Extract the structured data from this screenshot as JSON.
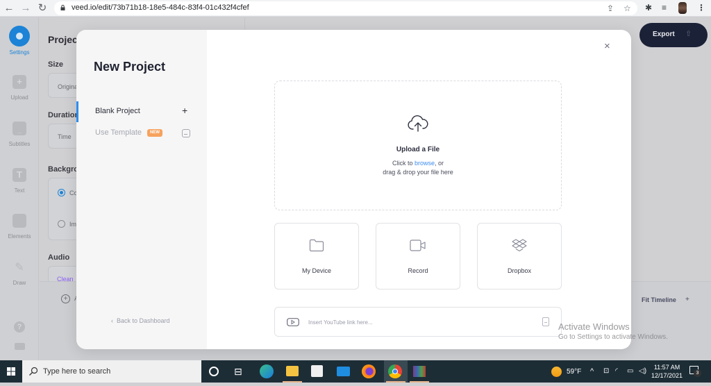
{
  "browser": {
    "url": "veed.io/edit/73b71b18-18e5-484c-83f4-01c432f4cfef",
    "back_icon": "arrow-left-icon",
    "forward_icon": "arrow-right-icon",
    "reload_icon": "reload-icon"
  },
  "app": {
    "left_nav": [
      {
        "label": "Settings",
        "icon": "settings-icon",
        "active": true
      },
      {
        "label": "Upload",
        "icon": "plus-icon"
      },
      {
        "label": "Subtitles",
        "icon": "subtitles-icon"
      },
      {
        "label": "Text",
        "icon": "text-icon",
        "glyph": "T"
      },
      {
        "label": "Elements",
        "icon": "elements-icon"
      },
      {
        "label": "Draw",
        "icon": "pencil-icon"
      }
    ],
    "panel": {
      "title": "Projec",
      "size_label": "Size",
      "size_value": "Origina",
      "duration_label": "Duration",
      "duration_value": "Time",
      "background_label": "Backgro",
      "bg_option_1": "Co",
      "bg_option_2": "Im",
      "audio_label": "Audio",
      "audio_value": "Clean",
      "add_label": "A"
    },
    "export_label": "Export",
    "fit_timeline_label": "Fit Timeline",
    "fit_plus": "+"
  },
  "modal": {
    "title": "New Project",
    "side_items": [
      {
        "label": "Blank Project",
        "icon": "+",
        "active": true
      },
      {
        "label": "Use Template",
        "badge": "NEW"
      }
    ],
    "back_label": "Back to Dashboard",
    "back_chevron": "‹",
    "close_glyph": "×",
    "upload": {
      "title": "Upload a File",
      "line1_prefix": "Click to ",
      "browse_link": "browse",
      "line1_suffix": ", or",
      "line2": "drag & drop your file here"
    },
    "sources": [
      {
        "label": "My Device",
        "icon": "folder-icon"
      },
      {
        "label": "Record",
        "icon": "video-camera-icon"
      },
      {
        "label": "Dropbox",
        "icon": "dropbox-icon"
      }
    ],
    "youtube": {
      "placeholder": "Insert YouTube link here...",
      "value": ""
    }
  },
  "watermark": {
    "line1": "Activate Windows",
    "line2": "Go to Settings to activate Windows."
  },
  "taskbar": {
    "search_placeholder": "Type here to search",
    "weather": "59°F",
    "time": "11:57 AM",
    "date": "12/17/2021",
    "notifications": "3",
    "colors": {
      "bg": "#1d2d36"
    }
  },
  "colors": {
    "accent": "#2e8ef0",
    "export_bg": "#1b2136",
    "new_badge": "#f6a25e",
    "link": "#3e8df0"
  }
}
